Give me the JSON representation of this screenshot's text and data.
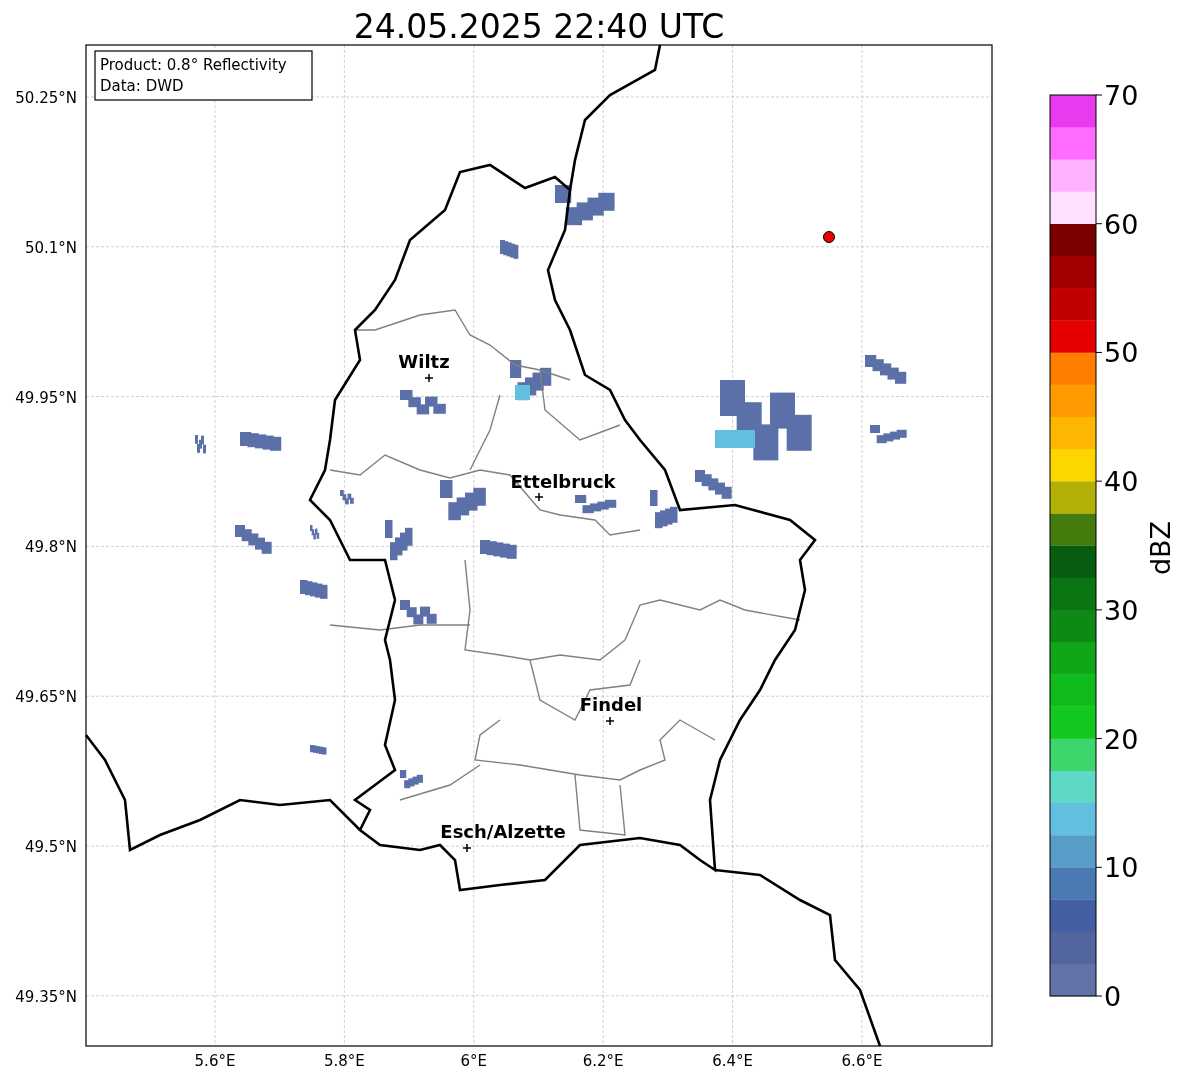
{
  "title": "24.05.2025 22:40 UTC",
  "info_box": [
    "Product: 0.8° Reflectivity",
    "Data: DWD"
  ],
  "lat_ticks": [
    "50.25°N",
    "50.1°N",
    "49.95°N",
    "49.8°N",
    "49.65°N",
    "49.5°N",
    "49.35°N"
  ],
  "lon_ticks": [
    "5.6°E",
    "5.8°E",
    "6°E",
    "6.2°E",
    "6.4°E",
    "6.6°E"
  ],
  "cities": [
    {
      "name": "Wiltz"
    },
    {
      "name": "Ettelbruck"
    },
    {
      "name": "Findel"
    },
    {
      "name": "Esch/Alzette"
    }
  ],
  "colorbar": {
    "label": "dBZ",
    "ticks": [
      "70",
      "60",
      "50",
      "40",
      "30",
      "20",
      "10",
      "0"
    ],
    "bins": [
      {
        "color": "#6373a8"
      },
      {
        "color": "#52659e"
      },
      {
        "color": "#435ea2"
      },
      {
        "color": "#4a79b4"
      },
      {
        "color": "#589dc8"
      },
      {
        "color": "#63bfe0"
      },
      {
        "color": "#60d8c6"
      },
      {
        "color": "#3dd66c"
      },
      {
        "color": "#13c81e"
      },
      {
        "color": "#10bb1c"
      },
      {
        "color": "#0fa718"
      },
      {
        "color": "#0c8a14"
      },
      {
        "color": "#0a7512"
      },
      {
        "color": "#075d0f"
      },
      {
        "color": "#437b0c"
      },
      {
        "color": "#b0b006"
      },
      {
        "color": "#fdd600"
      },
      {
        "color": "#fdb700"
      },
      {
        "color": "#ff9a00"
      },
      {
        "color": "#ff7e00"
      },
      {
        "color": "#e40000"
      },
      {
        "color": "#c00000"
      },
      {
        "color": "#a00000"
      },
      {
        "color": "#7a0000"
      },
      {
        "color": "#ffe0ff"
      },
      {
        "color": "#ffb2ff"
      },
      {
        "color": "#ff6cff"
      },
      {
        "color": "#e83aee"
      }
    ]
  }
}
